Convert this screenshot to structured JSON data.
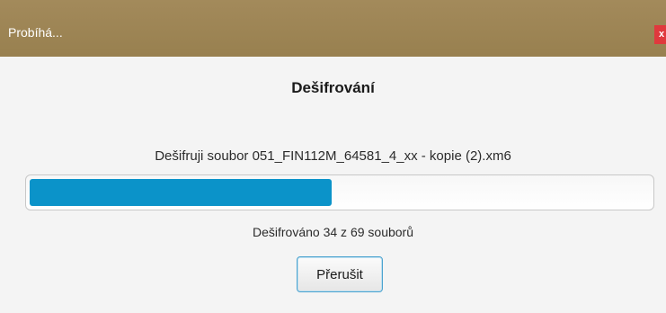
{
  "window": {
    "title": "Probíhá...",
    "close_label": "x"
  },
  "dialog": {
    "heading": "Dešifrování",
    "status": "Dešifruji soubor 051_FIN112M_64581_4_xx - kopie (2).xm6",
    "progress": {
      "done": 34,
      "total": 69,
      "fraction": 0.4928
    },
    "count_text": "Dešifrováno 34 z 69 souborů",
    "cancel_label": "Přerušit"
  },
  "colors": {
    "titlebar": "#9e8555",
    "close_button": "#e0393d",
    "progress_fill": "#0b93c9",
    "background": "#f4f4f4"
  }
}
